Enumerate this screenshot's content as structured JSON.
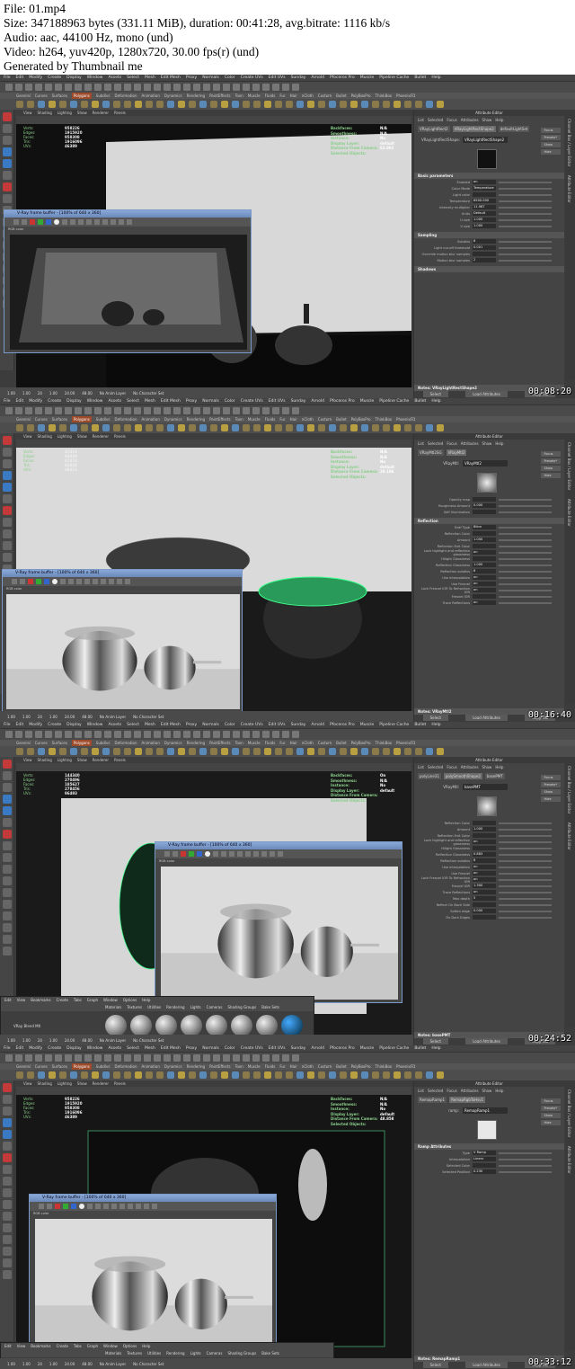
{
  "header": {
    "file": "File: 01.mp4",
    "size": "Size: 347188963 bytes (331.11 MiB), duration: 00:41:28, avg.bitrate: 1116 kb/s",
    "audio": "Audio: aac, 44100 Hz, mono (und)",
    "video": "Video: h264, yuv420p, 1280x720, 30.00 fps(r) (und)",
    "generator": "Generated by Thumbnail me"
  },
  "menus": [
    "File",
    "Edit",
    "Modify",
    "Create",
    "Display",
    "Window",
    "Assets",
    "Select",
    "Mesh",
    "Edit Mesh",
    "Proxy",
    "Normals",
    "Color",
    "Create UVs",
    "Edit UVs",
    "Sunday",
    "Arnold",
    "Pfoceros Pro",
    "Muscle",
    "Pipeline Cache",
    "Bullet",
    "Help"
  ],
  "shelf_tabs": [
    "General",
    "Curves",
    "Surfaces",
    "Polygons",
    "Subdivs",
    "Deformation",
    "Animation",
    "Dynamics",
    "Rendering",
    "PaintEffects",
    "Toon",
    "Muscle",
    "Fluids",
    "Fur",
    "Hair",
    "nCloth",
    "Custom",
    "Bullet",
    "PolyBoxPro",
    "ThinkBox",
    "PhoenixFD"
  ],
  "viewport_menu": [
    "View",
    "Shading",
    "Lighting",
    "Show",
    "Renderer",
    "Panels"
  ],
  "hud": {
    "labels": [
      "Verts:",
      "Edges:",
      "Faces:",
      "Tris:",
      "UVs:"
    ],
    "right_labels": [
      "Backfaces:",
      "Smoothness:",
      "Instance:",
      "Display Layer:",
      "Distance From Camera:",
      "Selected Objects:"
    ]
  },
  "attr_editor": {
    "title": "Attribute Editor",
    "tabs": [
      "List",
      "Selected",
      "Focus",
      "Attributes",
      "Show",
      "Help"
    ],
    "buttons": [
      "Focus",
      "Presets*",
      "Show",
      "Hide"
    ],
    "sample_label": "Sample",
    "bottom_buttons": [
      "Select",
      "Load Attributes",
      "Copy Tab"
    ],
    "side_tabs": [
      "Channel Box / Layer Editor",
      "Attribute Editor"
    ]
  },
  "timeline": {
    "values": [
      "1.00",
      "1.00",
      "24",
      "1.00",
      "24.00",
      "48.00",
      "No Anim Layer",
      "No Character Set"
    ]
  },
  "vray_window": {
    "title": "V-Ray frame buffer - [100% of 640 x 360]",
    "channel": "RGB color"
  },
  "frames": [
    {
      "timecode": "00:08:20",
      "attr_node_tabs": [
        "VRayLightRect2",
        "VRayLightRectShape2",
        "defaultLightSet"
      ],
      "attr_node_label": "VRayLightRectShape:",
      "attr_node_value": "VRayLightRectShape2",
      "hud_values": [
        "958226",
        "1915920",
        "958308",
        "1916096",
        "46389"
      ],
      "hud_right_values": [
        "N/A",
        "N/A",
        "No",
        "default",
        "62.892",
        ""
      ],
      "sections": [
        {
          "title": "Basic parameters",
          "rows": [
            {
              "label": "Enabled",
              "value": "on"
            },
            {
              "label": "Color Mode",
              "value": "Temperature"
            },
            {
              "label": "Light color",
              "value": ""
            },
            {
              "label": "Temperature",
              "value": "6500.000"
            },
            {
              "label": "Intensity multiplier",
              "value": "11.987"
            },
            {
              "label": "Units",
              "value": "Default"
            },
            {
              "label": "U size",
              "value": "1.000"
            },
            {
              "label": "V size",
              "value": "1.000"
            }
          ]
        },
        {
          "title": "Sampling",
          "rows": [
            {
              "label": "Subdivs",
              "value": "8"
            },
            {
              "label": "Light cut-off threshold",
              "value": "0.001"
            },
            {
              "label": "Override motion blur samples",
              "value": ""
            },
            {
              "label": "Motion blur samples",
              "value": "2"
            }
          ]
        },
        {
          "title": "Shadows",
          "rows": []
        }
      ],
      "notes": "Notes: VRayLightRectShape2"
    },
    {
      "timecode": "00:16:40",
      "attr_node_tabs": [
        "VRayMtl2SG",
        "VRayMtl2"
      ],
      "attr_node_label": "VRayMtl:",
      "attr_node_value": "VRayMtl2",
      "hud_values": [
        "47413",
        "94840",
        "47474",
        "94848",
        "48413"
      ],
      "hud_right_values": [
        "N/A",
        "N/A",
        "No",
        "default",
        "29.186",
        ""
      ],
      "sections": [
        {
          "title": "",
          "rows": [
            {
              "label": "Opacity map",
              "value": ""
            },
            {
              "label": "Roughness Amount",
              "value": "0.000"
            },
            {
              "label": "Self Illumination",
              "value": ""
            }
          ]
        },
        {
          "title": "Reflection",
          "rows": [
            {
              "label": "Brdf Type",
              "value": "Blinn"
            },
            {
              "label": "Reflection Color",
              "value": ""
            },
            {
              "label": "Amount",
              "value": "1.000"
            },
            {
              "label": "Reflection Exit Color",
              "value": ""
            },
            {
              "label": "Lock highlight and reflection glossiness",
              "value": "on"
            },
            {
              "label": "Hilight Glossiness",
              "value": ""
            },
            {
              "label": "Reflection Glossiness",
              "value": "1.000"
            },
            {
              "label": "Reflection subdivs",
              "value": "8"
            },
            {
              "label": "Use interpolation",
              "value": "on"
            },
            {
              "label": "Use Fresnel",
              "value": "on"
            },
            {
              "label": "Lock Fresnel IOR To Refraction IOR",
              "value": "on"
            },
            {
              "label": "Fresnel IOR",
              "value": ""
            },
            {
              "label": "Trace Reflections",
              "value": "on"
            }
          ]
        }
      ],
      "notes": "Notes: VRayMtl2"
    },
    {
      "timecode": "00:24:52",
      "attr_node_tabs": [
        "polyLine31",
        "polySmoothShape2",
        "basePMT"
      ],
      "attr_node_label": "VRayMtl:",
      "attr_node_value": "basePMT",
      "hud_values": [
        "144340",
        "270496",
        "185627",
        "278456",
        "96493"
      ],
      "hud_right_values": [
        "On",
        "N/A",
        "No",
        "default",
        "",
        ""
      ],
      "sections": [
        {
          "title": "",
          "rows": [
            {
              "label": "Reflection Color",
              "value": ""
            },
            {
              "label": "Amount",
              "value": "1.000"
            },
            {
              "label": "Reflection Exit Color",
              "value": ""
            },
            {
              "label": "Lock highlight and reflection glossiness",
              "value": "on"
            },
            {
              "label": "Hilight Glossiness",
              "value": ""
            },
            {
              "label": "Reflection Glossiness",
              "value": "0.883"
            },
            {
              "label": "Reflection subdivs",
              "value": "8"
            },
            {
              "label": "Use interpolation",
              "value": "on"
            },
            {
              "label": "Use Fresnel",
              "value": "on"
            },
            {
              "label": "Lock Fresnel IOR To Refraction IOR",
              "value": "on"
            },
            {
              "label": "Fresnel IOR",
              "value": "1.300"
            },
            {
              "label": "Trace Reflections",
              "value": "on"
            },
            {
              "label": "Max depth",
              "value": "5"
            },
            {
              "label": "Reflect On Back Side",
              "value": ""
            },
            {
              "label": "Soften edge",
              "value": "0.000"
            },
            {
              "label": "Fix Dark Edges",
              "value": ""
            }
          ]
        }
      ],
      "notes": "Notes: basePMT"
    },
    {
      "timecode": "00:33:12",
      "attr_node_tabs": [
        "RemapRamp1",
        "RemapRgbToHsv1"
      ],
      "attr_node_label": "ramp:",
      "attr_node_value": "RemapRamp1",
      "hud_values": [
        "958226",
        "1915920",
        "958308",
        "1916096",
        "46389"
      ],
      "hud_right_values": [
        "N/A",
        "N/A",
        "No",
        "default",
        "48.858",
        ""
      ],
      "sections": [
        {
          "title": "Ramp Attributes",
          "rows": [
            {
              "label": "Type",
              "value": "V Ramp"
            },
            {
              "label": "Interpolation",
              "value": "Linear"
            },
            {
              "label": "Selected Color",
              "value": ""
            },
            {
              "label": "Selected Position",
              "value": "0.230"
            }
          ]
        }
      ],
      "notes": "Notes: RemapRamp1"
    }
  ],
  "hypershade": {
    "menus": [
      "Edit",
      "View",
      "Bookmarks",
      "Create",
      "Tabs",
      "Graph",
      "Window",
      "Options",
      "Help"
    ],
    "tabs": [
      "Materials",
      "Textures",
      "Utilities",
      "Rendering",
      "Lights",
      "Cameras",
      "Shading Groups",
      "Bake Sets"
    ],
    "show_btn": "Show",
    "item": "VRay Blend Mtl"
  },
  "colors": {
    "maya_bg": "#3c3c3c",
    "accent_tab": "#9c4a2a",
    "hud_green": "#8acf8a",
    "vray_title": "#8aa8d8"
  }
}
